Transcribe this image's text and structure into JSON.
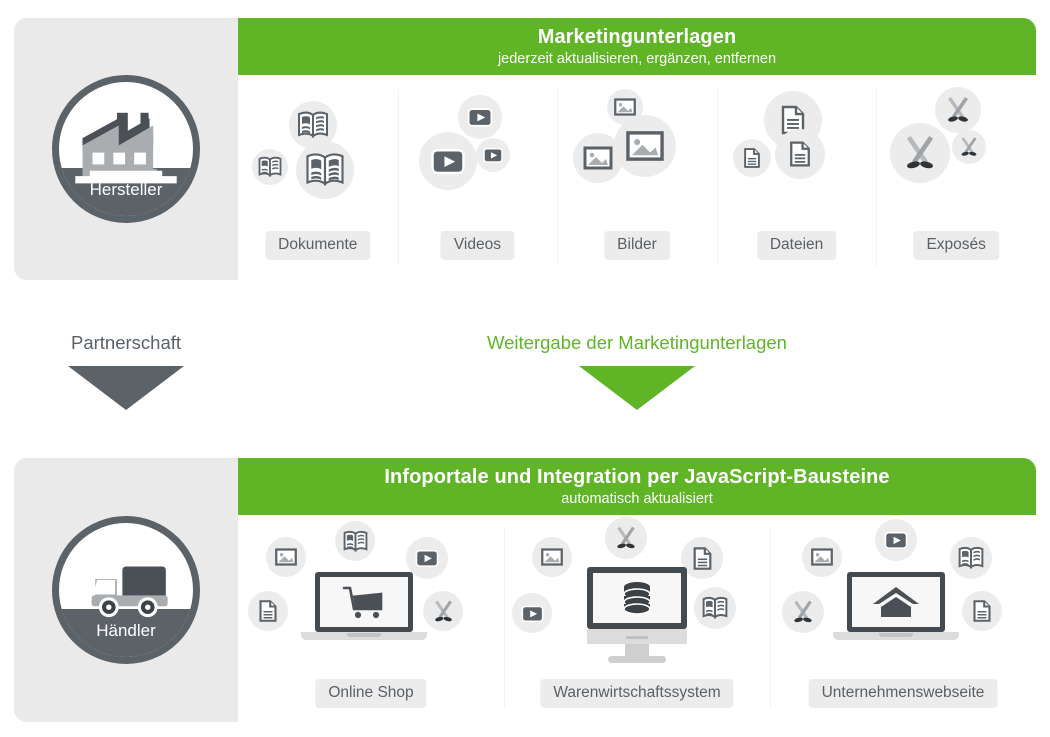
{
  "colors": {
    "green": "#5fb526",
    "dark_gray": "#5b6268",
    "panel_gray": "#eaeaea",
    "chip_gray": "#ececec",
    "text_gray": "#5a6066"
  },
  "top_panel": {
    "actor": {
      "label": "Hersteller",
      "icon": "factory-icon"
    },
    "band": {
      "title": "Marketingunterlagen",
      "subtitle": "jederzeit aktualisieren, ergänzen, entfernen"
    },
    "groups": [
      {
        "label": "Dokumente",
        "icon": "book-icon"
      },
      {
        "label": "Videos",
        "icon": "video-play-icon"
      },
      {
        "label": "Bilder",
        "icon": "image-icon"
      },
      {
        "label": "Dateien",
        "icon": "file-icon"
      },
      {
        "label": "Exposés",
        "icon": "spotlight-icon"
      }
    ]
  },
  "middle": {
    "left": {
      "label": "Partnerschaft",
      "arrow": "down-arrow-gray"
    },
    "right": {
      "label": "Weitergabe der Marketingunterlagen",
      "arrow": "down-arrow-green"
    }
  },
  "bottom_panel": {
    "actor": {
      "label": "Händler",
      "icon": "truck-icon"
    },
    "band": {
      "title": "Infoportale und Integration per JavaScript-Bausteine",
      "subtitle": "automatisch aktualisiert"
    },
    "groups": [
      {
        "label": "Online Shop",
        "device": "laptop-shopping-cart",
        "satellites": [
          "image-icon",
          "book-icon",
          "video-play-icon",
          "file-icon",
          "spotlight-icon"
        ]
      },
      {
        "label": "Warenwirtschaftssystem",
        "device": "monitor-database",
        "satellites": [
          "image-icon",
          "spotlight-icon",
          "file-icon",
          "video-play-icon",
          "book-icon"
        ]
      },
      {
        "label": "Unternehmenswebseite",
        "device": "laptop-house",
        "satellites": [
          "image-icon",
          "video-play-icon",
          "book-icon",
          "spotlight-icon",
          "file-icon"
        ]
      }
    ]
  }
}
